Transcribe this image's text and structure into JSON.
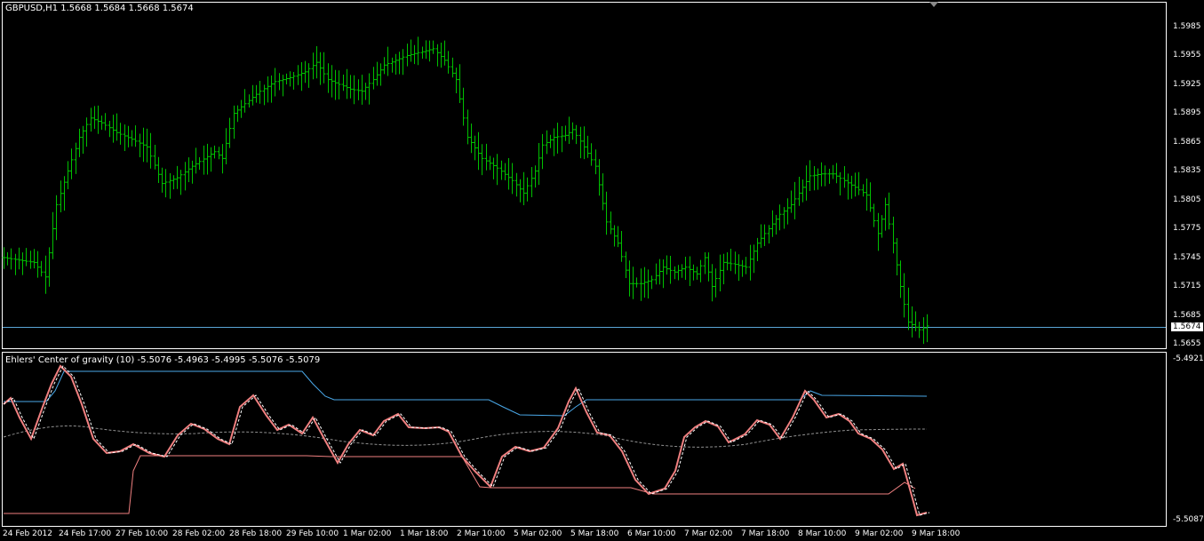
{
  "main_panel": {
    "title": "GBPUSD,H1  1.5668 1.5684 1.5668 1.5674",
    "price_ticks": [
      "1.5985",
      "1.5955",
      "1.5925",
      "1.5895",
      "1.5865",
      "1.5835",
      "1.5805",
      "1.5775",
      "1.5745",
      "1.5715",
      "1.5685",
      "1.5655"
    ],
    "current_price": "1.5674",
    "bar_color": "#00c000",
    "current_line_color": "#5aa6d6"
  },
  "indicator_panel": {
    "title": "Ehlers' Center of gravity (10) -5.5076 -5.4963 -5.4995 -5.5076 -5.5079",
    "ticks": [
      "-5.4921",
      "-5.5087"
    ],
    "colors": {
      "cg": "#f08080",
      "signal": "#ffffff",
      "upper": "#4aa8e8",
      "lower": "#f08080",
      "mid": "#909090"
    }
  },
  "time_axis": [
    "24 Feb 2012",
    "24 Feb 17:00",
    "27 Feb 10:00",
    "28 Feb 02:00",
    "28 Feb 18:00",
    "29 Feb 10:00",
    "1 Mar 02:00",
    "1 Mar 18:00",
    "2 Mar 10:00",
    "5 Mar 02:00",
    "5 Mar 18:00",
    "6 Mar 10:00",
    "7 Mar 02:00",
    "7 Mar 18:00",
    "8 Mar 10:00",
    "9 Mar 02:00",
    "9 Mar 18:00"
  ],
  "chart_data": {
    "type": "bar",
    "symbol": "GBPUSD",
    "timeframe": "H1",
    "ylim": [
      1.565,
      1.6
    ],
    "series": [
      {
        "name": "GBPUSD,H1",
        "close_path": [
          [
            0,
            1.5745
          ],
          [
            8,
            1.574
          ],
          [
            11,
            1.5725
          ],
          [
            14,
            1.58
          ],
          [
            17,
            1.5835
          ],
          [
            20,
            1.587
          ],
          [
            23,
            1.589
          ],
          [
            26,
            1.5885
          ],
          [
            30,
            1.5875
          ],
          [
            34,
            1.5868
          ],
          [
            38,
            1.586
          ],
          [
            42,
            1.5822
          ],
          [
            46,
            1.5828
          ],
          [
            50,
            1.584
          ],
          [
            54,
            1.585
          ],
          [
            56,
            1.5855
          ],
          [
            58,
            1.5848
          ],
          [
            61,
            1.5895
          ],
          [
            64,
            1.5905
          ],
          [
            68,
            1.5918
          ],
          [
            72,
            1.5928
          ],
          [
            76,
            1.5932
          ],
          [
            80,
            1.5938
          ],
          [
            83,
            1.5948
          ],
          [
            86,
            1.593
          ],
          [
            89,
            1.5925
          ],
          [
            92,
            1.592
          ],
          [
            95,
            1.5918
          ],
          [
            98,
            1.593
          ],
          [
            101,
            1.5945
          ],
          [
            104,
            1.595
          ],
          [
            107,
            1.5955
          ],
          [
            110,
            1.5958
          ],
          [
            114,
            1.5962
          ],
          [
            117,
            1.595
          ],
          [
            120,
            1.593
          ],
          [
            123,
            1.587
          ],
          [
            127,
            1.5848
          ],
          [
            131,
            1.5838
          ],
          [
            135,
            1.5825
          ],
          [
            138,
            1.5812
          ],
          [
            141,
            1.5835
          ],
          [
            143,
            1.5862
          ],
          [
            146,
            1.587
          ],
          [
            149,
            1.5872
          ],
          [
            151,
            1.5878
          ],
          [
            154,
            1.586
          ],
          [
            157,
            1.584
          ],
          [
            160,
            1.5782
          ],
          [
            163,
            1.576
          ],
          [
            166,
            1.5718
          ],
          [
            169,
            1.5718
          ],
          [
            172,
            1.5722
          ],
          [
            175,
            1.5735
          ],
          [
            178,
            1.573
          ],
          [
            181,
            1.5735
          ],
          [
            184,
            1.5728
          ],
          [
            186,
            1.5745
          ],
          [
            188,
            1.5715
          ],
          [
            191,
            1.574
          ],
          [
            194,
            1.5738
          ],
          [
            197,
            1.5735
          ],
          [
            200,
            1.576
          ],
          [
            203,
            1.5775
          ],
          [
            206,
            1.579
          ],
          [
            209,
            1.58
          ],
          [
            211,
            1.5812
          ],
          [
            214,
            1.583
          ],
          [
            217,
            1.5832
          ],
          [
            220,
            1.5832
          ],
          [
            223,
            1.5825
          ],
          [
            226,
            1.5818
          ],
          [
            229,
            1.581
          ],
          [
            232,
            1.577
          ],
          [
            234,
            1.58
          ],
          [
            236,
            1.576
          ],
          [
            238,
            1.5715
          ],
          [
            240,
            1.5678
          ],
          [
            243,
            1.567
          ],
          [
            245,
            1.5674
          ]
        ]
      }
    ]
  }
}
